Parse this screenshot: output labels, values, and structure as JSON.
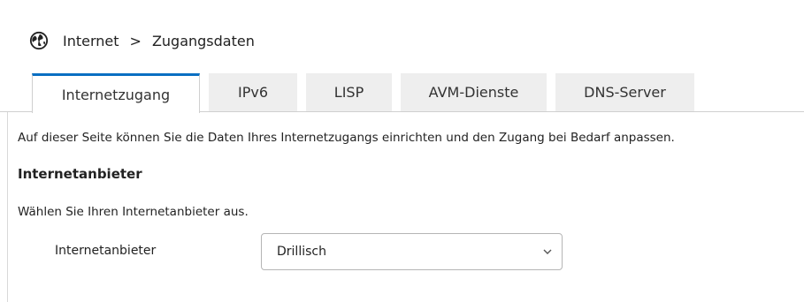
{
  "breadcrumb": {
    "icon": "globe-icon",
    "root": "Internet",
    "separator": ">",
    "current": "Zugangsdaten"
  },
  "tabs": [
    {
      "label": "Internetzugang",
      "active": true
    },
    {
      "label": "IPv6",
      "active": false
    },
    {
      "label": "LISP",
      "active": false
    },
    {
      "label": "AVM-Dienste",
      "active": false
    },
    {
      "label": "DNS-Server",
      "active": false
    }
  ],
  "main": {
    "intro": "Auf dieser Seite können Sie die Daten Ihres Internetzugangs einrichten und den Zugang bei Bedarf anpassen.",
    "section_title": "Internetanbieter",
    "choose_text": "Wählen Sie Ihren Internetanbieter aus.",
    "provider_field": {
      "label": "Internetanbieter",
      "value": "Drillisch"
    }
  },
  "colors": {
    "accent": "#0a6fc2",
    "tab_inactive_bg": "#eeeeee"
  }
}
